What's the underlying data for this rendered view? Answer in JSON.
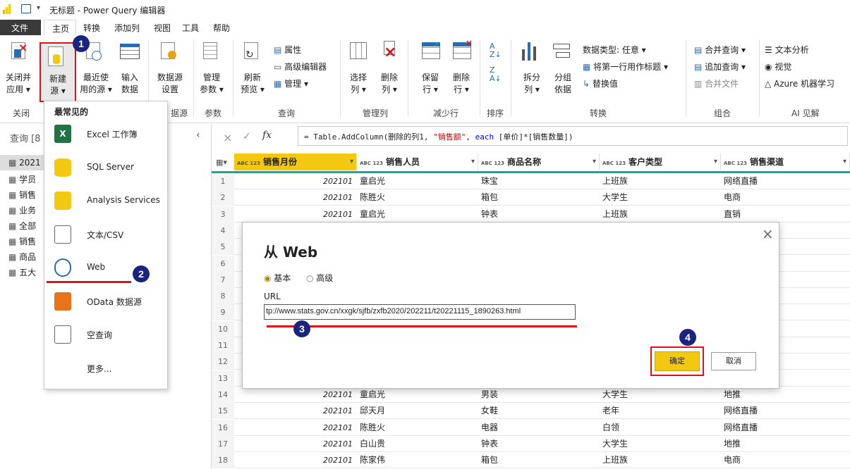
{
  "titlebar": {
    "title": "无标题 - Power Query 编辑器"
  },
  "menu": {
    "tabs": [
      "文件",
      "主页",
      "转换",
      "添加列",
      "视图",
      "工具",
      "帮助"
    ]
  },
  "ribbon": {
    "close_apply": "关闭并\n应用 ▾",
    "new_source": "新建\n源 ▾",
    "recent_sources": "最近使\n用的源 ▾",
    "enter_data": "输入\n数据",
    "ds_settings": "数据源\n设置",
    "manage_params": "管理\n参数 ▾",
    "refresh_preview": "刷新\n预览 ▾",
    "properties": "属性",
    "adv_editor": "高级编辑器",
    "manage": "管理 ▾",
    "choose_cols": "选择\n列 ▾",
    "remove_cols": "删除\n列 ▾",
    "keep_rows": "保留\n行 ▾",
    "remove_rows": "删除\n行 ▾",
    "split_col": "拆分\n列 ▾",
    "group_by": "分组\n依据",
    "data_type": "数据类型: 任意 ▾",
    "first_row_header": "将第一行用作标题 ▾",
    "replace_values": "替换值",
    "merge_queries": "合并查询 ▾",
    "append_queries": "追加查询 ▾",
    "combine_files": "合并文件",
    "text_analytics": "文本分析",
    "vision": "视觉",
    "azure_ml": "Azure 机器学习",
    "groups": {
      "close": "关闭",
      "source": "据源",
      "params": "参数",
      "query": "查询",
      "manage_cols": "管理列",
      "reduce_rows": "减少行",
      "sort": "排序",
      "transform": "转换",
      "combine": "组合",
      "ai": "AI 见解"
    }
  },
  "dropdown": {
    "header": "最常见的",
    "items": [
      "Excel 工作簿",
      "SQL Server",
      "Analysis Services",
      "文本/CSV",
      "Web",
      "OData 数据源",
      "空查询",
      "更多..."
    ]
  },
  "queries": {
    "header": "查询 [8",
    "items": [
      "2021",
      "学员",
      "销售",
      "业务",
      "全部",
      "销售",
      "商品",
      "五大"
    ]
  },
  "formula": {
    "fx": "fx",
    "text_prefix": "= Table.AddColumn(删除的列1, ",
    "text_str": "\"销售额\"",
    "text_mid": ", ",
    "text_kw": "each",
    "text_suffix": " [单价]*[销售数量])"
  },
  "grid": {
    "columns": [
      "销售月份",
      "销售人员",
      "商品名称",
      "客户类型",
      "销售渠道"
    ],
    "type_label": "ABC 123",
    "rows": [
      [
        "1",
        "202101",
        "童启光",
        "珠宝",
        "上班族",
        "网络直播"
      ],
      [
        "2",
        "202101",
        "陈胜火",
        "箱包",
        "大学生",
        "电商"
      ],
      [
        "3",
        "202101",
        "童启光",
        "钟表",
        "上班族",
        "直销"
      ],
      [
        "4",
        "",
        "",
        "",
        "",
        ""
      ],
      [
        "5",
        "",
        "",
        "",
        "",
        ""
      ],
      [
        "6",
        "",
        "",
        "",
        "",
        ""
      ],
      [
        "7",
        "",
        "",
        "",
        "",
        ""
      ],
      [
        "8",
        "",
        "",
        "",
        "",
        ""
      ],
      [
        "9",
        "",
        "",
        "",
        "",
        ""
      ],
      [
        "10",
        "",
        "",
        "",
        "",
        ""
      ],
      [
        "11",
        "",
        "",
        "",
        "",
        ""
      ],
      [
        "12",
        "",
        "",
        "",
        "",
        ""
      ],
      [
        "13",
        "",
        "",
        "",
        "",
        ""
      ],
      [
        "14",
        "202101",
        "童启光",
        "男装",
        "大学生",
        "地推"
      ],
      [
        "15",
        "202101",
        "邱天月",
        "女鞋",
        "老年",
        "网络直播"
      ],
      [
        "16",
        "202101",
        "陈胜火",
        "电器",
        "白领",
        "网络直播"
      ],
      [
        "17",
        "202101",
        "白山贵",
        "钟表",
        "大学生",
        "地推"
      ],
      [
        "18",
        "202101",
        "陈家伟",
        "箱包",
        "上班族",
        "电商"
      ]
    ]
  },
  "dialog": {
    "title": "从 Web",
    "basic": "基本",
    "advanced": "高级",
    "url_label": "URL",
    "url_value": "tp://www.stats.gov.cn/xxgk/sjfb/zxfb2020/202211/t20221115_1890263.html",
    "ok": "确定",
    "cancel": "取消",
    "close": "×"
  },
  "badges": [
    "1",
    "2",
    "3",
    "4"
  ],
  "colors": {
    "accent": "#f2c811",
    "highlight": "#d9141b",
    "badge": "#1a237e",
    "teal": "#14a89a"
  }
}
